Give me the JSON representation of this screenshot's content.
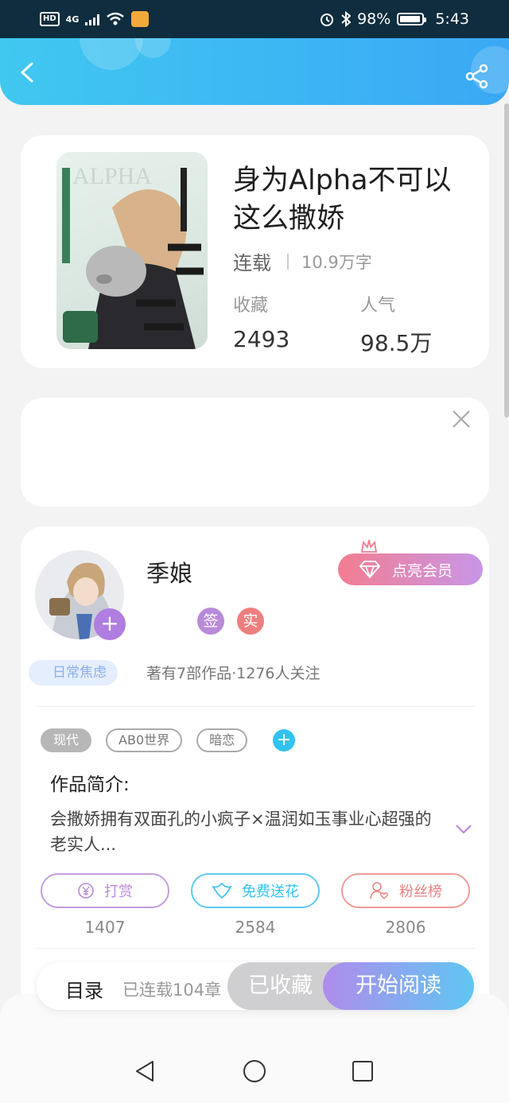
{
  "status_bar": {
    "hd": "HD",
    "signal": "4G",
    "battery": "98%",
    "time": "5:43"
  },
  "book": {
    "title": "身为Alpha不可以这么撒娇",
    "status": "连载",
    "word_count": "10.9万字",
    "collect_label": "收藏",
    "collect_count": "2493",
    "popularity_label": "人气",
    "popularity_count": "98.5万"
  },
  "author": {
    "name": "季娘",
    "mood": "日常焦虑",
    "vip_label": "点亮会员",
    "badge_sign": "签",
    "badge_real": "实",
    "stats": "著有7部作品·1276人关注",
    "avatar_alt": "avatar"
  },
  "tags": [
    "现代",
    "AB0世界",
    "暗恋"
  ],
  "intro": {
    "title": "作品简介:",
    "text": "会撒娇拥有双面孔的小疯子×温润如玉事业心超强的老实人..."
  },
  "actions": [
    {
      "label": "打赏",
      "count": "1407",
      "color": "#b98ad8"
    },
    {
      "label": "免费送花",
      "count": "2584",
      "color": "#33c2f0"
    },
    {
      "label": "粉丝榜",
      "count": "2806",
      "color": "#f08080"
    }
  ],
  "bottom_bar": {
    "toc_label": "目录",
    "toc_status": "已连载104章",
    "collected_label": "已收藏",
    "read_label": "开始阅读"
  },
  "colors": {
    "header_start": "#40c8f0",
    "header_end": "#3aa8f5",
    "accent_purple": "#b07de0",
    "accent_blue": "#33c2f0",
    "accent_pink": "#f08080"
  }
}
